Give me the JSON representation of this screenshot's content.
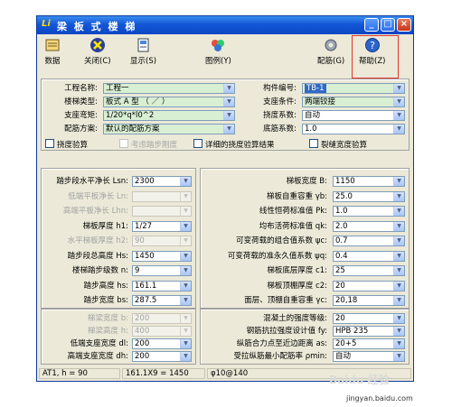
{
  "window": {
    "title": "梁 板 式 楼 梯",
    "app_icon": "Li"
  },
  "titlebar_buttons": [
    "_",
    "□",
    "×"
  ],
  "toolbar": {
    "data": "数据",
    "close": "关闭(C)",
    "display": "显示(S)",
    "drawing": "图例(Y)",
    "reinforcement": "配筋(G)",
    "help": "帮助(Z)"
  },
  "top_form": {
    "project_name_label": "工程名称:",
    "project_name": "工程一",
    "stair_type_label": "楼梯类型:",
    "stair_type": "板式 A 型 （ ／ ）",
    "support_bending_label": "支座弯矩:",
    "support_bending": "1/20*q*l0^2",
    "rebar_scheme_label": "配筋方案:",
    "rebar_scheme": "默认的配筋方案",
    "member_no_label": "构件编号:",
    "member_no": "TB-1",
    "support_cond_label": "支座条件:",
    "support_cond": "两端铰接",
    "deflection_coef_label": "挠度系数:",
    "deflection_coef": "自动",
    "bottom_rebar_label": "底筋系数:",
    "bottom_rebar": "1.0",
    "checks": {
      "deflection_check": "挠度验算",
      "stiffness_consider": "考虑踏步刚度",
      "detailed_result": "详细的挠度验算结果",
      "crack_check": "裂缝宽度验算"
    }
  },
  "left_mid": {
    "rows": [
      {
        "label": "踏步段水平净长 Lsn:",
        "value": "2300",
        "disabled": false
      },
      {
        "label": "低端平板净长 Ln:",
        "value": "",
        "disabled": true
      },
      {
        "label": "高端平板净长 Lhn:",
        "value": "",
        "disabled": true
      },
      {
        "label": "梯板厚度 h1:",
        "value": "1/27",
        "disabled": false
      },
      {
        "label": "水平梯板厚度 h2:",
        "value": "90",
        "disabled": true
      },
      {
        "label": "踏步段总高度 Hs:",
        "value": "1450",
        "disabled": false
      },
      {
        "label": "楼梯踏步级数 n:",
        "value": "9",
        "disabled": false
      },
      {
        "label": "踏步高度 hs:",
        "value": "161.1",
        "disabled": false
      },
      {
        "label": "踏步宽度 bs:",
        "value": "287.5",
        "disabled": false
      }
    ]
  },
  "right_mid": {
    "rows": [
      {
        "label": "梯板宽度 B:",
        "value": "1150"
      },
      {
        "label": "梯板自重容重 γb:",
        "value": "25.0"
      },
      {
        "label": "线性恒荷标准值 Pk:",
        "value": "1.0"
      },
      {
        "label": "均布活荷标准值 qk:",
        "value": "2.0"
      },
      {
        "label": "可变荷载的组合值系数 ψc:",
        "value": "0.7"
      },
      {
        "label": "可变荷载的准永久值系数 ψq:",
        "value": "0.4"
      },
      {
        "label": "梯板底层厚度 c1:",
        "value": "25"
      },
      {
        "label": "梯板顶棚厚度 c2:",
        "value": "20"
      },
      {
        "label": "面层、顶棚自重容重 γc:",
        "value": "20,18"
      }
    ]
  },
  "left_bot": {
    "rows": [
      {
        "label": "梯梁宽度 b:",
        "value": "200",
        "disabled": true
      },
      {
        "label": "梯梁高度 h:",
        "value": "400",
        "disabled": true
      },
      {
        "label": "低端支座宽度 dl:",
        "value": "200",
        "disabled": false
      },
      {
        "label": "高端支座宽度 dh:",
        "value": "200",
        "disabled": false
      }
    ]
  },
  "right_bot": {
    "rows": [
      {
        "label": "混凝土的强度等级:",
        "value": "20"
      },
      {
        "label": "钢筋抗拉强度设计值 fy:",
        "value": "HPB 235"
      },
      {
        "label": "纵筋合力点至近边距离 as:",
        "value": "20+5"
      },
      {
        "label": "受拉纵筋最小配筋率 ρmin:",
        "value": "自动"
      }
    ]
  },
  "statusbar": {
    "a": "AT1, h = 90",
    "b": "161.1X9 = 1450",
    "c": "φ10@140"
  },
  "watermark": {
    "text": "Baidu 经验",
    "url": "jingyan.baidu.com"
  }
}
